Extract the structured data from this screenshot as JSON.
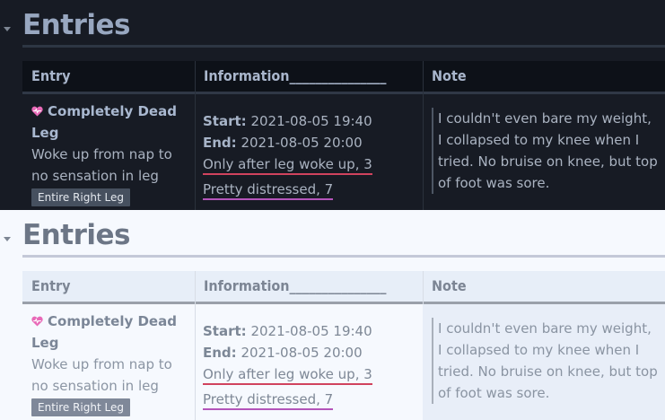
{
  "sections": [
    {
      "theme": "dark",
      "heading": "Entries",
      "columns": [
        "Entry",
        "Information_______________",
        "Note"
      ],
      "entry": {
        "title": "Completely Dead Leg",
        "description": "Woke up from nap to no sensation in leg",
        "tag": "Entire Right Leg"
      },
      "info": {
        "start_label": "Start:",
        "start_value": "2021-08-05 19:40",
        "end_label": "End:",
        "end_value": "2021-08-05 20:00",
        "link1": "Only after leg woke up, 3",
        "link2": "Pretty distressed, 7"
      },
      "note": "I couldn't even bare my weight, I collapsed to my knee when I tried. No bruise on knee, but top of foot was sore."
    },
    {
      "theme": "light",
      "heading": "Entries",
      "columns": [
        "Entry",
        "Information_______________",
        "Note"
      ],
      "entry": {
        "title": "Completely Dead Leg",
        "description": "Woke up from nap to no sensation in leg",
        "tag": "Entire Right Leg"
      },
      "info": {
        "start_label": "Start:",
        "start_value": "2021-08-05 19:40",
        "end_label": "End:",
        "end_value": "2021-08-05 20:00",
        "link1": "Only after leg woke up, 3",
        "link2": "Pretty distressed, 7"
      },
      "note": "I couldn't even bare my weight, I collapsed to my knee when I tried. No bruise on knee, but top of foot was sore."
    }
  ],
  "colors": {
    "heart": "#e86ab8",
    "link_underline_1": "#d0435e",
    "link_underline_2": "#b455ba"
  },
  "icons": {
    "heart": "heart-icon",
    "collapse": "collapse-arrow-icon"
  }
}
